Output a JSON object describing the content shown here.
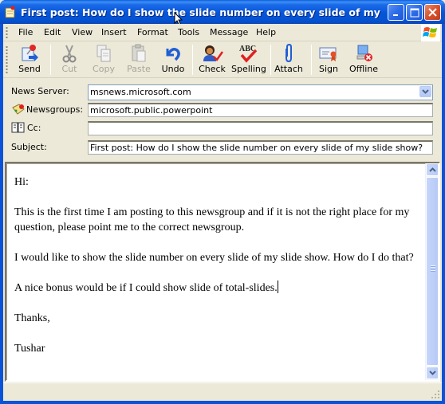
{
  "window": {
    "title": "First post: How do I show the slide number on every slide of my slide s...",
    "buttons": [
      "minimize",
      "maximize",
      "close"
    ]
  },
  "menubar": {
    "items": [
      {
        "label": "File"
      },
      {
        "label": "Edit"
      },
      {
        "label": "View"
      },
      {
        "label": "Insert"
      },
      {
        "label": "Format"
      },
      {
        "label": "Tools"
      },
      {
        "label": "Message"
      },
      {
        "label": "Help"
      }
    ]
  },
  "toolbar": {
    "buttons": [
      {
        "label": "Send",
        "icon": "send-icon",
        "enabled": true
      },
      {
        "label": "Cut",
        "icon": "scissors-icon",
        "enabled": false
      },
      {
        "label": "Copy",
        "icon": "copy-icon",
        "enabled": false
      },
      {
        "label": "Paste",
        "icon": "paste-icon",
        "enabled": false
      },
      {
        "label": "Undo",
        "icon": "undo-icon",
        "enabled": true
      },
      {
        "label": "Check",
        "icon": "check-names-icon",
        "enabled": true
      },
      {
        "label": "Spelling",
        "icon": "spelling-icon",
        "enabled": true
      },
      {
        "label": "Attach",
        "icon": "paperclip-icon",
        "enabled": true
      },
      {
        "label": "Sign",
        "icon": "certificate-icon",
        "enabled": true
      },
      {
        "label": "Offline",
        "icon": "offline-icon",
        "enabled": true
      }
    ]
  },
  "header": {
    "news_server": {
      "label": "News Server:",
      "value": "msnews.microsoft.com"
    },
    "newsgroups": {
      "label": "Newsgroups:",
      "value": "microsoft.public.powerpoint"
    },
    "cc": {
      "label": "Cc:",
      "value": ""
    },
    "subject": {
      "label": "Subject:",
      "value": "First post: How do I show the slide number on every slide of my slide show?"
    }
  },
  "message": {
    "paragraphs": [
      "Hi:",
      "This is the first time I am posting to this newsgroup and if it is not the right place for my question, please point me to the correct newsgroup.",
      "I would like to show the slide number on every slide of my slide show.  How do I do that?",
      "A nice bonus would be if I could show slide of total-slides.",
      "Thanks,",
      "Tushar"
    ]
  },
  "colors": {
    "titlebar": "#0555da",
    "chrome": "#ece9d8",
    "close_button": "#d8512e",
    "scrollbar": "#c6d6fb"
  }
}
